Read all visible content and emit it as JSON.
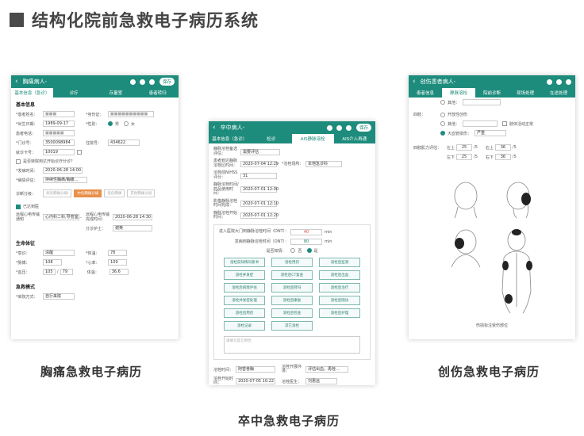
{
  "page_title": "结构化院前急救电子病历系统",
  "captions": {
    "left": "胸痛急救电子病历",
    "middle": "卒中急救电子病历",
    "right": "创伤急救电子病历"
  },
  "colors": {
    "header": "#1e8c7c",
    "accent_orange": "#e9904a"
  },
  "left": {
    "header_title": "胸痛病人-",
    "pill": "保存",
    "tabs": [
      "基本信息（急诊）",
      "诊疗",
      "存量室",
      "患者转归"
    ],
    "section_basic": "基本信息",
    "fields": {
      "name_label": "*患者姓名：",
      "id_label": "*身份证：",
      "dob_label": "*出生日期：",
      "dob": "1989-09-17",
      "sex_label": "*性别：",
      "male": "男",
      "female": "女",
      "phone_label": "患者电话：",
      "clinic_label": "*门诊号：",
      "clinic": "3500098984",
      "inpatient_label": "住院号：",
      "inpatient": "434622",
      "card_label": "就诊卡号：",
      "card": "10019",
      "arrive_chk": "是否转院到达开始诊疗分诊？",
      "onset_label": "*发病时间：",
      "onset": "2020-06-28 14:00",
      "eval_label": "*病情评估：",
      "eval": "持续性胸痛/胸痛…",
      "chips_label": "诊断分级：",
      "chips": [
        "高危胸痛分级I",
        "中危胸痛分级",
        "低危胸痛",
        "其他胸痛分级"
      ],
      "doctor_chk": "已达到医",
      "notify_label": "远程心电传输通知",
      "notify": "心内科二科,导管室…",
      "notify_time_label": "远程心电传输完成时间：",
      "notify_time": "2020-06-28 14:30",
      "nurse_label": "分诊护士：",
      "nurse": "谢英"
    },
    "section_vitals": "生命体征",
    "vitals": {
      "consciousness_label": "*意识：",
      "consciousness": "清醒",
      "temp_label": "*体温：",
      "temp": "78",
      "pulse_label": "*脉搏：",
      "pulse": "108",
      "hr_label": "*心率：",
      "hr": "109",
      "bp_label": "*血压：",
      "bp_sys": "105",
      "bp_dia": "79",
      "weight_label": "体温：",
      "weight": "36.6"
    },
    "section_mode": "急救模式",
    "mode_label": "*来院方式：",
    "mode": "自行来院"
  },
  "middle": {
    "header_title": "卒中病人-",
    "pill": "保存",
    "tabs": [
      "基本信息（急诊）",
      "检诊",
      "AIS静脉溶栓",
      "AIS介入再通"
    ],
    "fields": {
      "a_label": "静脉溶栓备选评估：",
      "a": "需要评估",
      "b_label": "患者到达静脉溶栓区时间：",
      "b": "2020-07-04 12:29",
      "c_label": "*溶栓场所：",
      "c": "本地急诊科",
      "d_label": "溶栓前NIHSS评分：",
      "d": "31",
      "e_label": "静脉溶栓时间/药品使用时间：",
      "e": "2020-07-01 12:00",
      "f_label": "影像静脉溶栓时间完成：",
      "f": "2020-07-01 12:10",
      "g_label": "静脉溶栓开始时间：",
      "g": "2020-07-01 12:20"
    },
    "dnt_label": "进入医院大门到静脉溶栓时间（DNT）：",
    "dnt": "40",
    "ont_label": "发病到静脉溶栓时间（ONT）：",
    "ont": "80",
    "unit": "min",
    "consent_label": "是否知情：",
    "no": "否",
    "yes": "是",
    "buttons": [
      "溶栓前知情同意书",
      "溶栓用药",
      "溶栓后监测",
      "溶栓并发症",
      "溶栓后CT复查",
      "溶栓后出血",
      "溶栓后病情评估",
      "溶栓后转归",
      "溶栓后治疗",
      "溶栓并发症处理",
      "溶栓后康复",
      "溶栓后随访",
      "溶栓后用药",
      "溶栓后检查",
      "溶栓后护理",
      "溶栓记录",
      "其它溶栓"
    ],
    "note_placeholder": "请填写其它原因",
    "bottom": {
      "h_label": "溶栓时间：",
      "h": "阿替普酶",
      "i_label": "溶栓开始时间：",
      "i": "2020-07-05 10:22",
      "j_label": "溶栓开展环境：",
      "j": "评估出血，再栓…",
      "k_label": "溶栓医生：",
      "k": "刘惠远"
    }
  },
  "right": {
    "header_title": "创伤患者病人-",
    "tabs": [
      "患者信息",
      "静脉溶栓",
      "院前诊断",
      "现场处理",
      "在途处理"
    ],
    "options": [
      "其他：",
      "开放性创伤",
      "其他：",
      "大血管损伤："
    ],
    "sub_label": "四肢：",
    "severe": "严重",
    "check_text": "肢体活动正常",
    "power_label": "四肢肌力评估：",
    "power": {
      "upper_left_label": "左上",
      "upper_left": "25",
      "upper_right_label": "右上",
      "upper_right": "36",
      "lower_left_label": "左下",
      "lower_left": "25",
      "lower_right_label": "右下",
      "lower_right": "36",
      "slash": "/5"
    },
    "body_caption": "伤损标注受伤部位"
  }
}
